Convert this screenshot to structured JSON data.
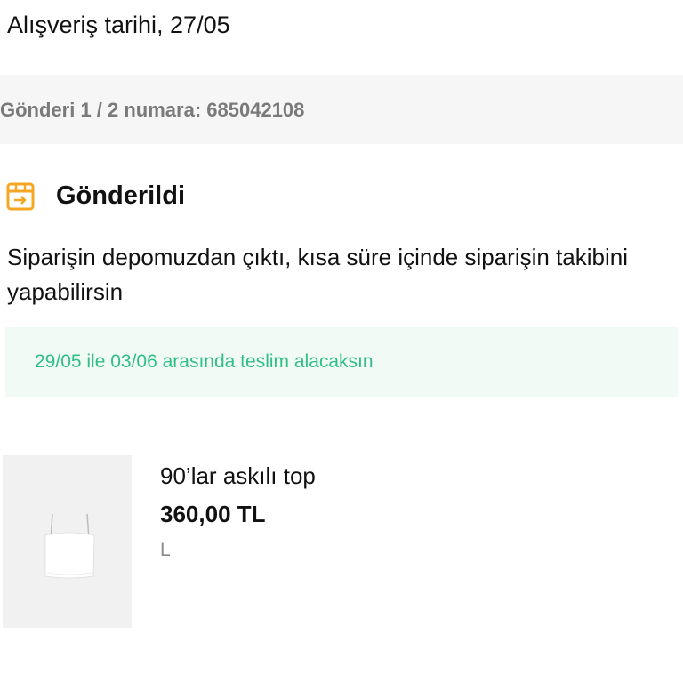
{
  "order": {
    "purchase_date": "Alışveriş tarihi, 27/05"
  },
  "shipment": {
    "label": "Gönderi 1 / 2 numara: 685042108"
  },
  "status": {
    "icon": "package-shipped-icon",
    "icon_color": "#f5a623",
    "title": "Gönderildi",
    "description": "Siparişin depomuzdan çıktı, kısa süre içinde siparişin takibini yapabilirsin"
  },
  "delivery": {
    "text": "29/05 ile 03/06 arasında teslim alacaksın",
    "text_color": "#2fbf86",
    "background": "#f2faf6"
  },
  "product": {
    "image_icon": "white-strappy-top-image",
    "name": "90’lar askılı top",
    "price": "360,00 TL",
    "size": "L"
  }
}
